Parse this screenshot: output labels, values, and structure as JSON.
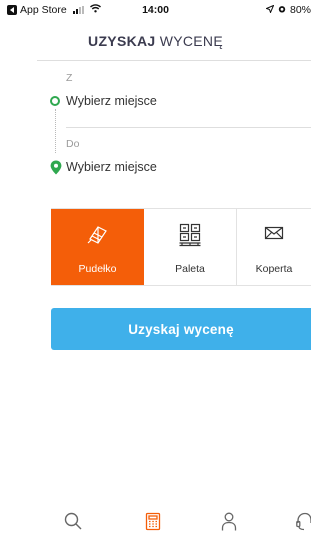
{
  "status_bar": {
    "back_app": "App Store",
    "time": "14:00",
    "battery": "80%"
  },
  "header": {
    "title_bold": "UZYSKAJ",
    "title_regular": "WYCENĘ"
  },
  "route": {
    "from_label": "Z",
    "from_placeholder": "Wybierz miejsce",
    "to_label": "Do",
    "to_placeholder": "Wybierz miejsce"
  },
  "package_types": [
    {
      "label": "Pudełko",
      "icon": "box-icon",
      "selected": true
    },
    {
      "label": "Paleta",
      "icon": "pallet-icon",
      "selected": false
    },
    {
      "label": "Koperta",
      "icon": "envelope-icon",
      "selected": false
    }
  ],
  "cta": {
    "label": "Uzyskaj wycenę"
  },
  "bottom_nav": [
    {
      "icon": "search-icon"
    },
    {
      "icon": "calculator-icon",
      "active": true
    },
    {
      "icon": "profile-icon"
    },
    {
      "icon": "support-icon"
    }
  ],
  "colors": {
    "accent_orange": "#f45e09",
    "button_blue": "#3fb0ea",
    "route_green": "#2fa84f"
  }
}
